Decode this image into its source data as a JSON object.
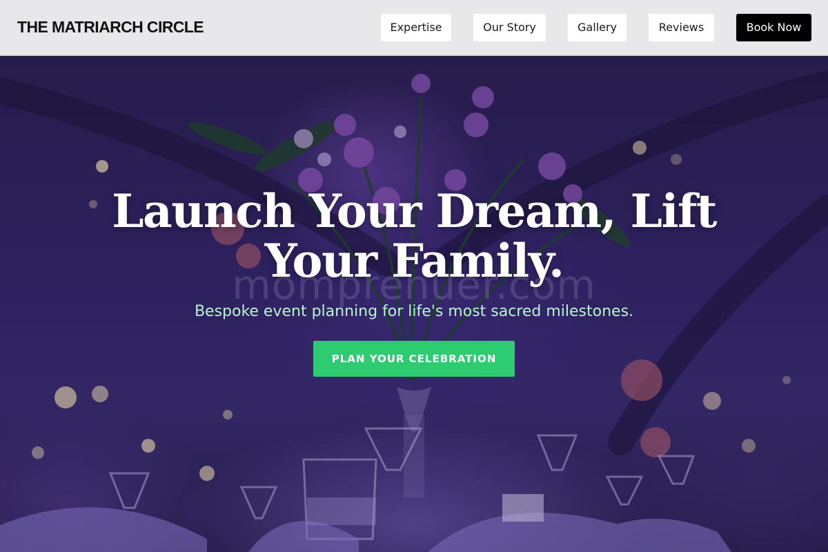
{
  "header": {
    "logo": "THE MATRIARCH CIRCLE",
    "nav": {
      "expertise": "Expertise",
      "our_story": "Our Story",
      "gallery": "Gallery",
      "reviews": "Reviews",
      "book_now": "Book Now"
    }
  },
  "hero": {
    "title_line1": "Launch Your Dream, Lift",
    "title_line2": "Your Family.",
    "watermark": "momprenuer.com",
    "subtitle": "Bespoke event planning for life's most sacred milestones.",
    "cta": "PLAN YOUR CELEBRATION"
  },
  "colors": {
    "header_bg": "#e8e8eb",
    "book_button_bg": "#000000",
    "cta_bg": "#2ecc71",
    "subtitle": "#b9f3cf",
    "hero_tint": "#33266a"
  }
}
